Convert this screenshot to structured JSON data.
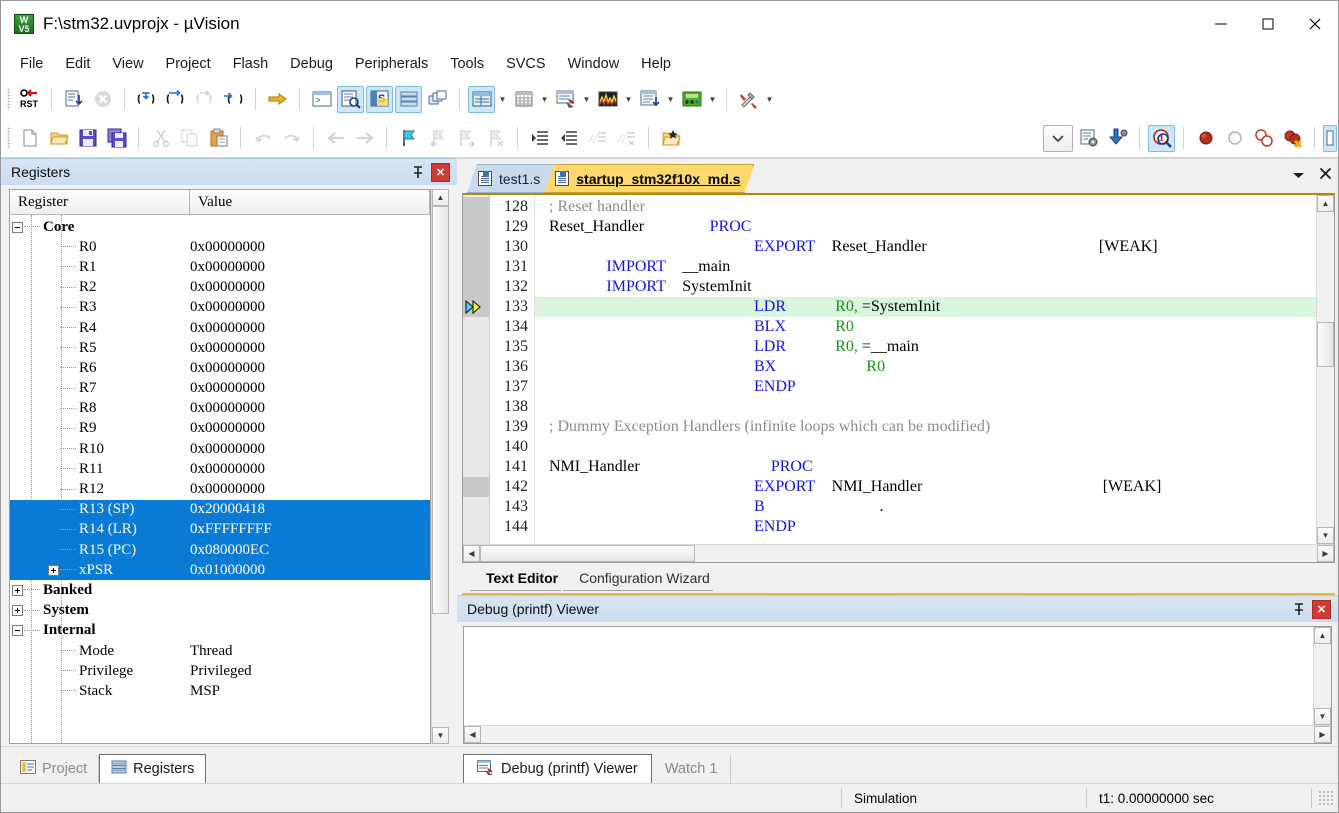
{
  "window": {
    "title": "F:\\stm32.uvprojx - µVision",
    "icon": "uvision-logo-icon",
    "minimize_label": "minimize-icon",
    "maximize_label": "maximize-icon",
    "close_label": "close-icon"
  },
  "menu": {
    "items": [
      "File",
      "Edit",
      "View",
      "Project",
      "Flash",
      "Debug",
      "Peripherals",
      "Tools",
      "SVCS",
      "Window",
      "Help"
    ]
  },
  "toolbar_debug": {
    "buttons": [
      {
        "name": "reset-cpu",
        "icon": "rst-icon"
      },
      {
        "name": "run",
        "icon": "run-icon"
      },
      {
        "name": "stop",
        "icon": "stop-icon"
      },
      {
        "name": "step",
        "icon": "step-into-icon"
      },
      {
        "name": "step-over",
        "icon": "step-over-icon"
      },
      {
        "name": "step-out",
        "icon": "step-out-icon"
      },
      {
        "name": "run-to-cursor",
        "icon": "run-to-cursor-icon"
      },
      {
        "name": "show-next-statement",
        "icon": "yellow-arrow-icon"
      },
      {
        "name": "command-window",
        "icon": "command-window-icon"
      },
      {
        "name": "disassembly-window",
        "icon": "disassembly-icon"
      },
      {
        "name": "symbol-window",
        "icon": "symbols-icon"
      },
      {
        "name": "registers-window",
        "icon": "registers-icon"
      },
      {
        "name": "call-stack-window",
        "icon": "call-stack-icon"
      },
      {
        "name": "watch-windows",
        "icon": "watch-icon"
      },
      {
        "name": "memory-windows",
        "icon": "memory-icon"
      },
      {
        "name": "serial-windows",
        "icon": "serial-icon"
      },
      {
        "name": "analysis-windows",
        "icon": "logic-analyzer-icon"
      },
      {
        "name": "trace-windows",
        "icon": "trace-icon"
      },
      {
        "name": "system-viewer",
        "icon": "system-viewer-icon"
      },
      {
        "name": "toolbox",
        "icon": "toolbox-icon"
      }
    ]
  },
  "toolbar_file": {
    "buttons": [
      {
        "name": "new-file",
        "icon": "new-document-icon"
      },
      {
        "name": "open-file",
        "icon": "open-folder-icon"
      },
      {
        "name": "save",
        "icon": "floppy-save-icon"
      },
      {
        "name": "save-all",
        "icon": "save-all-icon"
      },
      {
        "name": "cut",
        "icon": "scissors-icon"
      },
      {
        "name": "copy",
        "icon": "copy-icon"
      },
      {
        "name": "paste",
        "icon": "clipboard-paste-icon"
      },
      {
        "name": "undo",
        "icon": "undo-arrow-icon"
      },
      {
        "name": "redo",
        "icon": "redo-arrow-icon"
      },
      {
        "name": "navigate-back",
        "icon": "back-arrow-icon"
      },
      {
        "name": "navigate-forward",
        "icon": "forward-arrow-icon"
      },
      {
        "name": "bookmark-toggle",
        "icon": "blue-flag-icon"
      },
      {
        "name": "bookmark-prev",
        "icon": "flag-back-icon"
      },
      {
        "name": "bookmark-next",
        "icon": "flag-forward-icon"
      },
      {
        "name": "bookmark-clear",
        "icon": "flag-clear-icon"
      },
      {
        "name": "indent",
        "icon": "indent-icon"
      },
      {
        "name": "outdent",
        "icon": "outdent-icon"
      },
      {
        "name": "comment-block",
        "icon": "comment-icon"
      },
      {
        "name": "uncomment-block",
        "icon": "uncomment-icon"
      },
      {
        "name": "open-project",
        "icon": "open-project-icon"
      },
      {
        "name": "target-select",
        "icon": "chevron-down-icon"
      },
      {
        "name": "target-options",
        "icon": "target-options-icon"
      },
      {
        "name": "download",
        "icon": "download-icon"
      },
      {
        "name": "start-stop-debug",
        "icon": "debug-magnifier-icon"
      },
      {
        "name": "insert-breakpoint",
        "icon": "breakpoint-red-icon"
      },
      {
        "name": "disable-breakpoint",
        "icon": "breakpoint-hollow-icon"
      },
      {
        "name": "disable-all-breakpoints",
        "icon": "breakpoints-disable-all-icon"
      },
      {
        "name": "kill-all-breakpoints",
        "icon": "breakpoints-kill-all-icon"
      }
    ]
  },
  "registers_panel": {
    "title": "Registers",
    "pin_icon": "pin-icon",
    "close_icon": "close-icon",
    "columns": [
      "Register",
      "Value"
    ],
    "rows": [
      {
        "level": 0,
        "name": "Core",
        "value": "",
        "expander": "minus",
        "selected": false
      },
      {
        "level": 2,
        "name": "R0",
        "value": "0x00000000",
        "selected": false
      },
      {
        "level": 2,
        "name": "R1",
        "value": "0x00000000",
        "selected": false
      },
      {
        "level": 2,
        "name": "R2",
        "value": "0x00000000",
        "selected": false
      },
      {
        "level": 2,
        "name": "R3",
        "value": "0x00000000",
        "selected": false
      },
      {
        "level": 2,
        "name": "R4",
        "value": "0x00000000",
        "selected": false
      },
      {
        "level": 2,
        "name": "R5",
        "value": "0x00000000",
        "selected": false
      },
      {
        "level": 2,
        "name": "R6",
        "value": "0x00000000",
        "selected": false
      },
      {
        "level": 2,
        "name": "R7",
        "value": "0x00000000",
        "selected": false
      },
      {
        "level": 2,
        "name": "R8",
        "value": "0x00000000",
        "selected": false
      },
      {
        "level": 2,
        "name": "R9",
        "value": "0x00000000",
        "selected": false
      },
      {
        "level": 2,
        "name": "R10",
        "value": "0x00000000",
        "selected": false
      },
      {
        "level": 2,
        "name": "R11",
        "value": "0x00000000",
        "selected": false
      },
      {
        "level": 2,
        "name": "R12",
        "value": "0x00000000",
        "selected": false
      },
      {
        "level": 2,
        "name": "R13 (SP)",
        "value": "0x20000418",
        "selected": true
      },
      {
        "level": 2,
        "name": "R14 (LR)",
        "value": "0xFFFFFFFF",
        "selected": true
      },
      {
        "level": 2,
        "name": "R15 (PC)",
        "value": "0x080000EC",
        "selected": true
      },
      {
        "level": 1,
        "name": "xPSR",
        "value": "0x01000000",
        "expander": "plus",
        "selected": true
      },
      {
        "level": 0,
        "name": "Banked",
        "value": "",
        "expander": "plus",
        "selected": false
      },
      {
        "level": 0,
        "name": "System",
        "value": "",
        "expander": "plus",
        "selected": false
      },
      {
        "level": 0,
        "name": "Internal",
        "value": "",
        "expander": "minus",
        "selected": false
      },
      {
        "level": 2,
        "name": "Mode",
        "value": "Thread",
        "selected": false
      },
      {
        "level": 2,
        "name": "Privilege",
        "value": "Privileged",
        "selected": false
      },
      {
        "level": 2,
        "name": "Stack",
        "value": "MSP",
        "selected": false
      }
    ]
  },
  "left_dock_tabs": [
    {
      "label": "Project",
      "icon": "project-icon",
      "selected": false
    },
    {
      "label": "Registers",
      "icon": "registers-icon",
      "selected": true
    }
  ],
  "editor": {
    "tabs": [
      {
        "label": "test1.s",
        "icon": "asm-file-icon",
        "active": false
      },
      {
        "label": "startup_stm32f10x_md.s",
        "icon": "asm-file-icon",
        "active": true
      }
    ],
    "window_menu_icon": "chevron-down-icon",
    "window_close_icon": "close-icon",
    "first_line_number": 128,
    "current_line_number": 133,
    "execution_marker_icon": "execution-point-arrow-icon",
    "lines": [
      {
        "n": 128,
        "tokens": [
          {
            "t": "; Reset handler",
            "c": "cmt",
            "pad": 0
          }
        ]
      },
      {
        "n": 129,
        "tokens": [
          {
            "t": "Reset_Handler",
            "c": "plain",
            "pad": 0
          },
          {
            "t": "PROC",
            "c": "kw",
            "pad": 8
          }
        ]
      },
      {
        "n": 130,
        "tokens": [
          {
            "t": "EXPORT",
            "c": "kw",
            "pad": 25
          },
          {
            "t": "Reset_Handler",
            "c": "plain",
            "pad": 2
          },
          {
            "t": "[WEAK]",
            "c": "plain",
            "pad": 21
          }
        ]
      },
      {
        "n": 131,
        "tokens": [
          {
            "t": "IMPORT",
            "c": "kw",
            "pad": 7
          },
          {
            "t": "__main",
            "c": "plain",
            "pad": 2
          }
        ]
      },
      {
        "n": 132,
        "tokens": [
          {
            "t": "IMPORT",
            "c": "kw",
            "pad": 7
          },
          {
            "t": "SystemInit",
            "c": "plain",
            "pad": 2
          }
        ]
      },
      {
        "n": 133,
        "current": true,
        "tokens": [
          {
            "t": "LDR",
            "c": "kw",
            "pad": 25
          },
          {
            "t": "R0, ",
            "c": "reg-tok",
            "pad": 6
          },
          {
            "t": "=SystemInit",
            "c": "plain",
            "pad": 0
          }
        ]
      },
      {
        "n": 134,
        "tokens": [
          {
            "t": "BLX",
            "c": "kw",
            "pad": 25
          },
          {
            "t": "R0",
            "c": "reg-tok",
            "pad": 6
          }
        ]
      },
      {
        "n": 135,
        "tokens": [
          {
            "t": "LDR",
            "c": "kw",
            "pad": 25
          },
          {
            "t": "R0, ",
            "c": "reg-tok",
            "pad": 6
          },
          {
            "t": "=__main",
            "c": "plain",
            "pad": 0
          }
        ]
      },
      {
        "n": 136,
        "tokens": [
          {
            "t": "BX",
            "c": "kw",
            "pad": 25
          },
          {
            "t": "R0",
            "c": "reg-tok",
            "pad": 11
          }
        ]
      },
      {
        "n": 137,
        "tokens": [
          {
            "t": "ENDP",
            "c": "kw",
            "pad": 25
          }
        ]
      },
      {
        "n": 138,
        "tokens": []
      },
      {
        "n": 139,
        "tokens": [
          {
            "t": "; Dummy Exception Handlers (infinite loops which can be modified)",
            "c": "cmt",
            "pad": 0
          }
        ]
      },
      {
        "n": 140,
        "tokens": []
      },
      {
        "n": 141,
        "tokens": [
          {
            "t": "NMI_Handler",
            "c": "plain",
            "pad": 0
          },
          {
            "t": "PROC",
            "c": "kw",
            "pad": 16
          }
        ]
      },
      {
        "n": 142,
        "tokens": [
          {
            "t": "EXPORT",
            "c": "kw",
            "pad": 25
          },
          {
            "t": "NMI_Handler",
            "c": "plain",
            "pad": 2
          },
          {
            "t": "[WEAK]",
            "c": "plain",
            "pad": 22
          }
        ]
      },
      {
        "n": 143,
        "tokens": [
          {
            "t": "B",
            "c": "kw",
            "pad": 25
          },
          {
            "t": ".",
            "c": "plain",
            "pad": 14
          }
        ]
      },
      {
        "n": 144,
        "tokens": [
          {
            "t": "ENDP",
            "c": "kw",
            "pad": 25
          }
        ]
      }
    ],
    "bottom_tabs": [
      {
        "label": "Text Editor",
        "selected": true
      },
      {
        "label": "Configuration Wizard",
        "selected": false
      }
    ]
  },
  "debug_viewer": {
    "title": "Debug (printf) Viewer",
    "pin_icon": "pin-icon",
    "close_icon": "close-icon",
    "content": ""
  },
  "bottom_dock_tabs": [
    {
      "label": "Debug (printf) Viewer",
      "icon": "debug-viewer-icon",
      "selected": true
    },
    {
      "label": "Watch 1",
      "icon": "",
      "selected": false
    }
  ],
  "statusbar": {
    "simulation": "Simulation",
    "time": "t1: 0.00000000 sec"
  },
  "colors": {
    "selection_blue": "#0a7bd4",
    "current_line_green": "#d9f5dd",
    "active_tab_yellow": "#ffd86b",
    "inactive_tab_blue": "#c8d9ec",
    "keyword_blue": "#1414d8",
    "register_green": "#149414",
    "comment_gray": "#8c8c8c",
    "panel_caption": "#d6e5f2",
    "close_red": "#cf3b36"
  }
}
